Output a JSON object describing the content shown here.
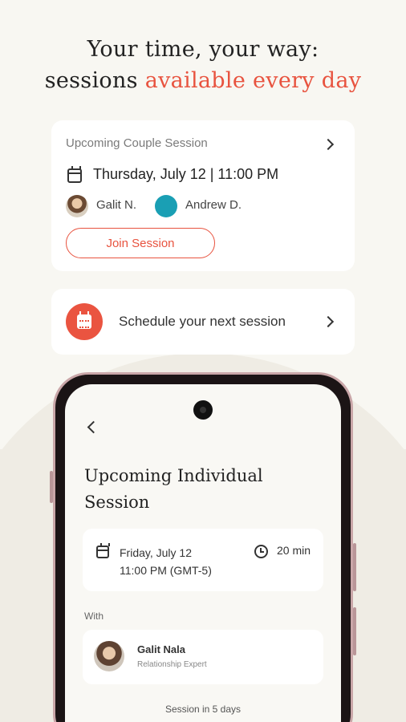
{
  "headline": {
    "line1": "Your time, your way:",
    "line2_plain": "sessions ",
    "line2_accent": "available every day"
  },
  "upcoming_couple": {
    "title": "Upcoming Couple Session",
    "datetime": "Thursday, July 12 | 11:00 PM",
    "participants": [
      "Galit N.",
      "Andrew D."
    ],
    "join_label": "Join Session"
  },
  "schedule": {
    "label": "Schedule your next session"
  },
  "phone_screen": {
    "title": "Upcoming Individual Session",
    "date": "Friday, July 12",
    "time": "11:00 PM (GMT-5)",
    "duration": "20 min",
    "with_label": "With",
    "expert_name": "Galit Nala",
    "expert_role": "Relationship Expert",
    "session_in": "Session in 5 days"
  },
  "colors": {
    "accent": "#e8533f",
    "background": "#f8f7f2",
    "avatar_teal": "#1a9fb4"
  },
  "icons": [
    "calendar-icon",
    "chevron-right-icon",
    "schedule-calendar-icon",
    "back-chevron-icon",
    "clock-icon",
    "camera-cutout"
  ]
}
